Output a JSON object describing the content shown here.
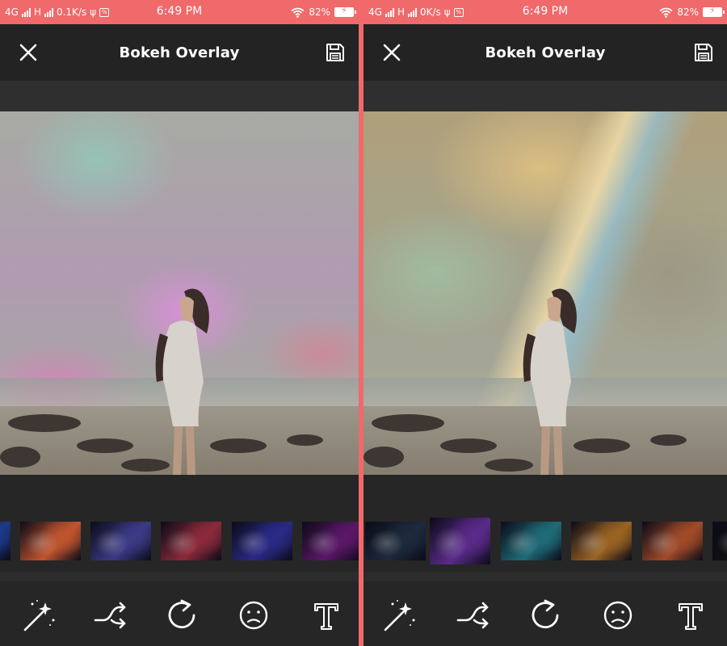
{
  "screens": [
    {
      "status": {
        "network_1": "4G",
        "network_2": "H",
        "speed": "0.1K/s",
        "usb_symbol": "ψ",
        "app_badge": "%",
        "time": "6:49 PM",
        "battery": "82%"
      },
      "header": {
        "title": "Bokeh Overlay"
      },
      "overlays": [
        {
          "name": "blue-star-overlay",
          "color": "#1e3a8a"
        },
        {
          "name": "orange-teal-nebula-overlay",
          "color": "#c0552e"
        },
        {
          "name": "purple-haze-overlay",
          "color": "#3c3a86"
        },
        {
          "name": "red-pink-nebula-overlay",
          "color": "#8b2a3a"
        },
        {
          "name": "blue-violet-overlay",
          "color": "#2a2a86"
        },
        {
          "name": "magenta-glow-overlay",
          "color": "#5a1766"
        }
      ]
    },
    {
      "status": {
        "network_1": "4G",
        "network_2": "H",
        "speed": "0K/s",
        "usb_symbol": "ψ",
        "app_badge": "%",
        "time": "6:49 PM",
        "battery": "82%"
      },
      "header": {
        "title": "Bokeh Overlay"
      },
      "overlays": [
        {
          "name": "dark-starfield-overlay",
          "color": "#1d2a3c"
        },
        {
          "name": "purple-galaxy-overlay",
          "color": "#5a2a8a"
        },
        {
          "name": "teal-nebula-overlay",
          "color": "#1f6b77"
        },
        {
          "name": "golden-comet-overlay",
          "color": "#9a6322"
        },
        {
          "name": "orange-blue-nebula-overlay",
          "color": "#a14a28"
        },
        {
          "name": "black-starfield-overlay",
          "color": "#111111"
        }
      ],
      "selected_overlay": 1
    }
  ],
  "toolbar": [
    "magic-wand",
    "shuffle",
    "rotate",
    "face",
    "text"
  ],
  "colors": {
    "accent": "#f0696b",
    "header_bg": "#232323",
    "panel_bg": "#262626"
  }
}
